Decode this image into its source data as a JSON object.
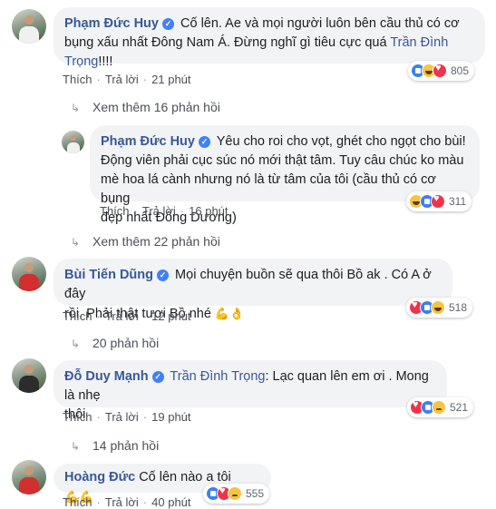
{
  "comments": [
    {
      "author": "Phạm Đức Huy",
      "text_1": "Cố lên. Ae và mọi người luôn bên cầu thủ có cơ",
      "text_2a": "bụng xấu nhất Đông Nam Á. Đừng nghĩ gì tiêu cực quá ",
      "mention": "Trần Đình",
      "text_3a": "Trọng",
      "text_3b": "!!!!",
      "like": "Thích",
      "reply": "Trả lời",
      "time": "21 phút",
      "reaction_count": "805",
      "reactions": [
        "like",
        "haha",
        "love"
      ],
      "more_replies": "Xem thêm 16 phản hồi"
    },
    {
      "author": "Phạm Đức Huy",
      "text_1": "Yêu cho roi cho vọt, ghét cho ngọt cho bùi!",
      "text_2": "Động viên phải cục súc nó mới thật tâm. Tuy câu chúc ko màu",
      "text_3": "mè hoa lá cành nhưng nó là từ tâm của tôi (cầu thủ có cơ bụng",
      "text_4": "đẹp nhất Đông Dương)",
      "like": "Thích",
      "reply": "Trả lời",
      "time": "16 phút",
      "reaction_count": "311",
      "reactions": [
        "haha",
        "like",
        "love"
      ],
      "more_replies": "Xem thêm 22 phản hồi"
    },
    {
      "author": "Bùi Tiến Dũng",
      "text_1": "Mọi chuyện buồn sẽ qua thôi Bồ ak . Có A ở đây",
      "text_2": "rồi. Phải thật tươi Bồ nhé",
      "emoji": "💪👌",
      "like": "Thích",
      "reply": "Trả lời",
      "time": "12 phút",
      "reaction_count": "518",
      "reactions": [
        "love",
        "like",
        "haha"
      ],
      "more_replies": "20 phản hồi"
    },
    {
      "author": "Đỗ Duy Mạnh",
      "mention": "Trần Đình Trọng",
      "text_1": ": Lạc quan lên em ơi . Mong là nhẹ",
      "text_2": "thôi",
      "like": "Thích",
      "reply": "Trả lời",
      "time": "19 phút",
      "reaction_count": "521",
      "reactions": [
        "love",
        "like",
        "sad"
      ],
      "more_replies": "14 phản hồi"
    },
    {
      "author": "Hoàng Đức",
      "text_1": "Cố lên nào a tôi",
      "emoji": "💪💪",
      "like": "Thích",
      "reply": "Trả lời",
      "time": "40 phút",
      "reaction_count": "555",
      "reactions": [
        "like",
        "love",
        "sad"
      ]
    }
  ]
}
